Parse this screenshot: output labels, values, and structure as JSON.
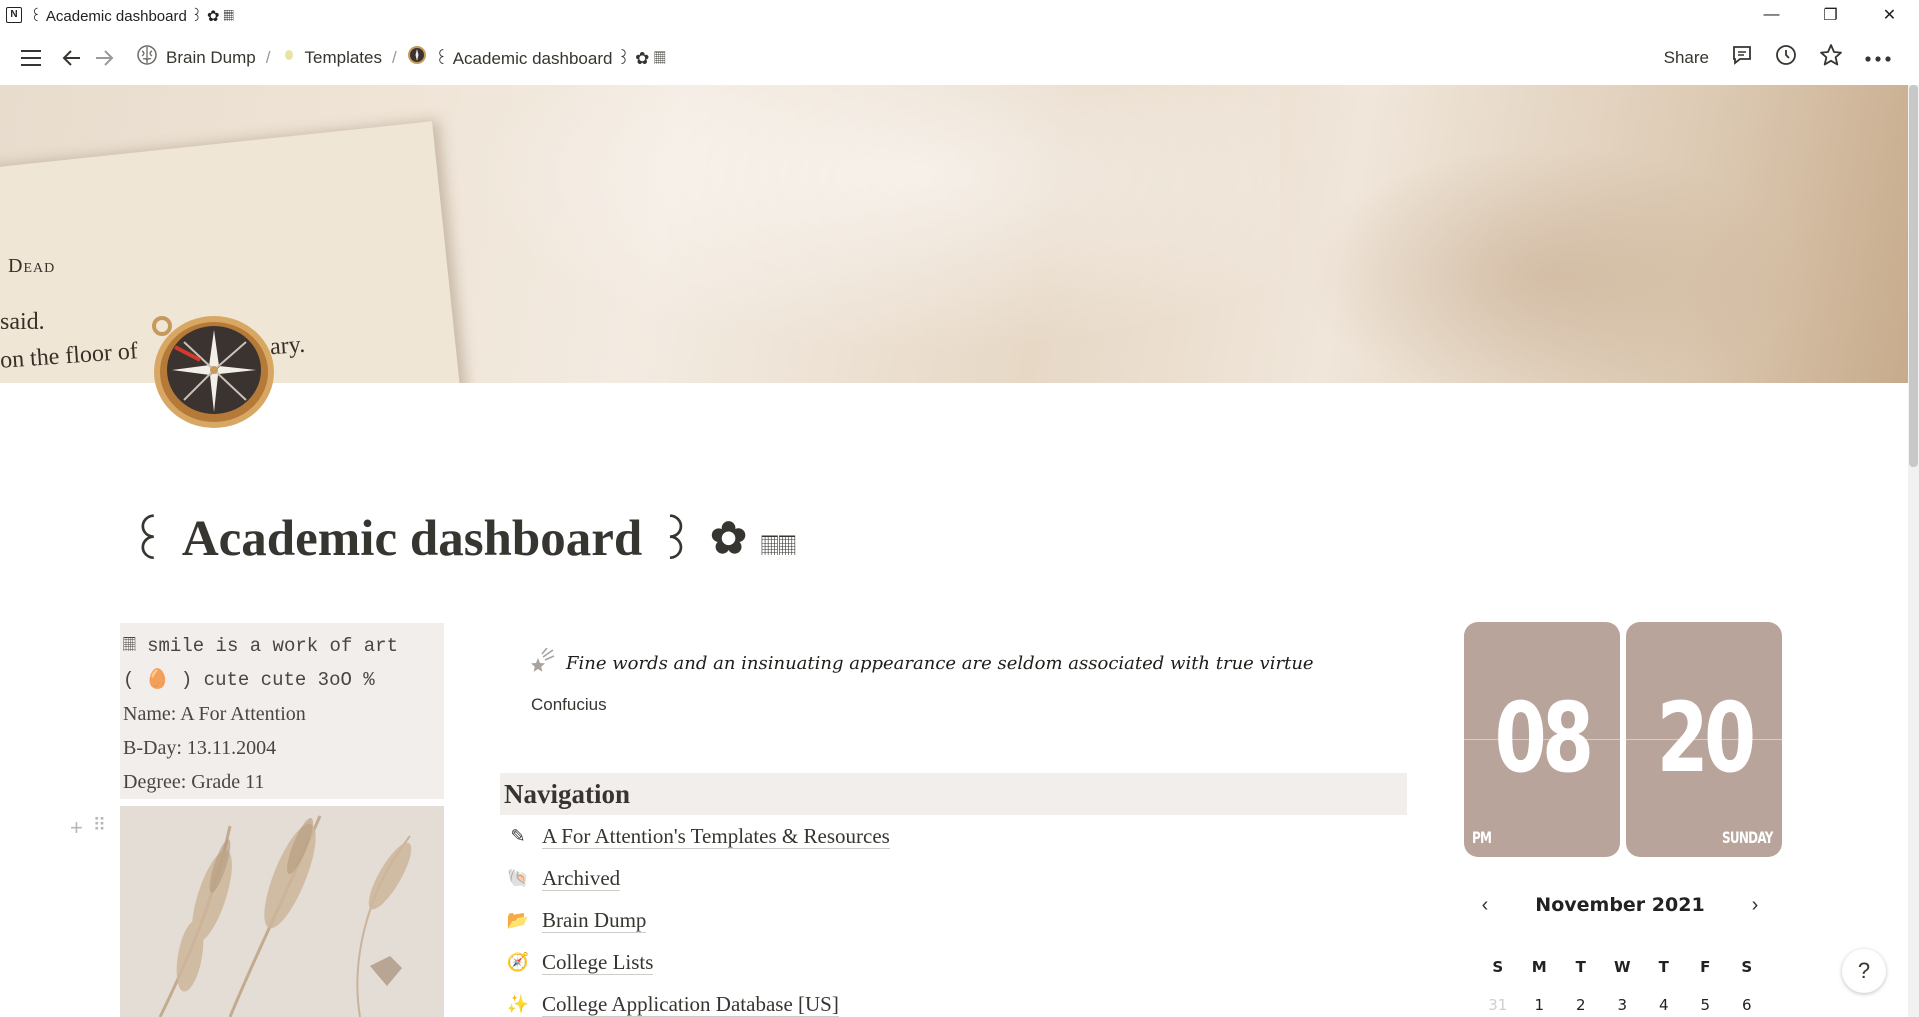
{
  "window": {
    "title": "꒰ Academic dashboard ꒱ ✿ 𝄜",
    "app_icon": "N",
    "controls": {
      "minimize": "—",
      "maximize": "❐",
      "close": "✕"
    }
  },
  "topbar": {
    "breadcrumbs": [
      {
        "label": "Brain Dump",
        "icon": "brain-icon"
      },
      {
        "label": "Templates",
        "icon": "leaf-icon"
      },
      {
        "label": "꒰ Academic dashboard ꒱ ✿ 𝄜",
        "icon": "compass-icon"
      }
    ],
    "separator": "/",
    "share_label": "Share"
  },
  "cover": {
    "book_words": [
      "Dead",
      "said.",
      "on the floor of",
      "ary."
    ]
  },
  "page": {
    "title_prefix": "꒰",
    "title": "Academic dashboard",
    "title_suffix": "꒱",
    "title_flower": "✿",
    "title_fence": "𝄜𝄜"
  },
  "profile": {
    "line1": "𝄜 smile is a work of art",
    "line2": "( 🥚 ) cute cute 3oO %",
    "name": "Name: A For Attention",
    "bday": "B-Day: 13.11.2004",
    "degree": "Degree: Grade 11"
  },
  "quote": {
    "text": "Fine words and an insinuating appearance are seldom associated with true virtue",
    "author": "Confucius"
  },
  "navigation": {
    "heading": "Navigation",
    "items": [
      {
        "emoji": "✎",
        "label": "A For Attention's Templates & Resources"
      },
      {
        "emoji": "🐚",
        "label": "Archived"
      },
      {
        "emoji": "📂",
        "label": "Brain Dump"
      },
      {
        "emoji": "🧭",
        "label": "College Lists"
      },
      {
        "emoji": "✨",
        "label": "College Application Database [US]"
      }
    ]
  },
  "clock": {
    "hours": "08",
    "minutes": "20",
    "meridiem": "PM",
    "weekday": "SUNDAY",
    "tile_color": "#b8a49a"
  },
  "calendar": {
    "month": "November 2021",
    "weekdays": [
      "S",
      "M",
      "T",
      "W",
      "T",
      "F",
      "S"
    ],
    "first_row": [
      "31",
      "1",
      "2",
      "3",
      "4",
      "5",
      "6"
    ]
  },
  "help": {
    "label": "?"
  },
  "colors": {
    "panel_bg": "#f1eeec",
    "text": "#37352f"
  }
}
